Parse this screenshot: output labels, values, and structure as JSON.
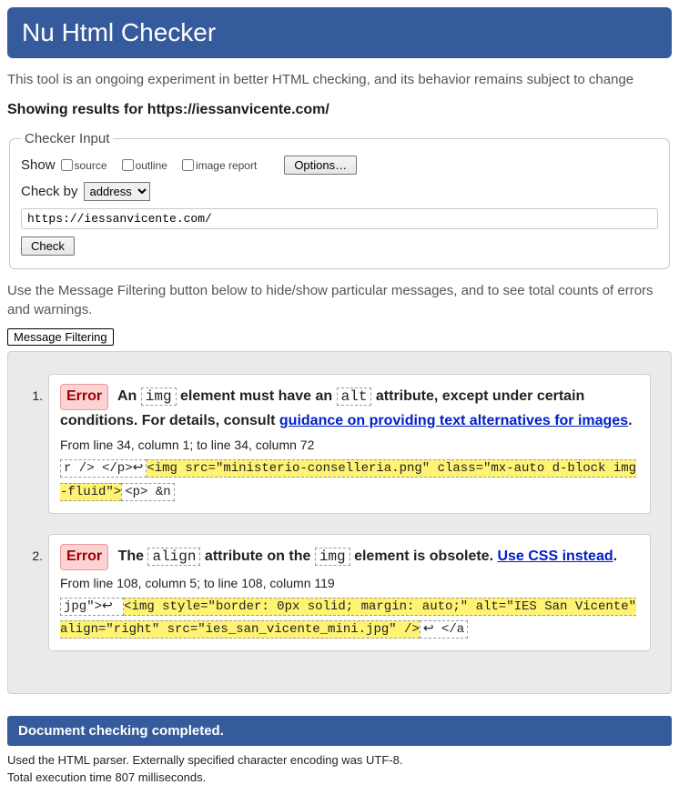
{
  "header": {
    "title": "Nu Html Checker"
  },
  "intro": "This tool is an ongoing experiment in better HTML checking, and its behavior remains subject to change",
  "results_heading": "Showing results for https://iessanvicente.com/",
  "checker": {
    "legend": "Checker Input",
    "show_label": "Show",
    "checkboxes": {
      "source": "source",
      "outline": "outline",
      "image_report": "image report"
    },
    "options_btn": "Options…",
    "check_by_label": "Check by",
    "check_by_selected": "address",
    "url_value": "https://iessanvicente.com/",
    "check_btn": "Check"
  },
  "filter": {
    "help": "Use the Message Filtering button below to hide/show particular messages, and to see total counts of errors and warnings.",
    "button": "Message Filtering"
  },
  "messages": [
    {
      "type": "Error",
      "title_parts": {
        "pre": "An ",
        "tok1": "img",
        "mid": " element must have an ",
        "tok2": "alt",
        "post": " attribute, except under certain conditions. For details, consult ",
        "link_text": "guidance on providing text alternatives for images",
        "tail": "."
      },
      "location": "From line 34, column 1; to line 34, column 72",
      "extract": {
        "before": "r /> </p>↩",
        "highlight": "<img src=\"ministerio-conselleria.png\" class=\"mx-auto d-block img-fluid\">",
        "after": "<p> &n"
      }
    },
    {
      "type": "Error",
      "title_parts": {
        "pre": "The ",
        "tok1": "align",
        "mid": " attribute on the ",
        "tok2": "img",
        "post": " element is obsolete. ",
        "link_text": "Use CSS instead",
        "tail": "."
      },
      "location": "From line 108, column 5; to line 108, column 119",
      "extract": {
        "before": "jpg\">↩    ",
        "highlight": "<img style=\"border: 0px solid; margin: auto;\" alt=\"IES San Vicente\" align=\"right\" src=\"ies_san_vicente_mini.jpg\" />",
        "after": "↩  </a"
      }
    }
  ],
  "footer": {
    "completed": "Document checking completed.",
    "parser_line": "Used the HTML parser. Externally specified character encoding was UTF-8.",
    "time_line": "Total execution time 807 milliseconds."
  }
}
